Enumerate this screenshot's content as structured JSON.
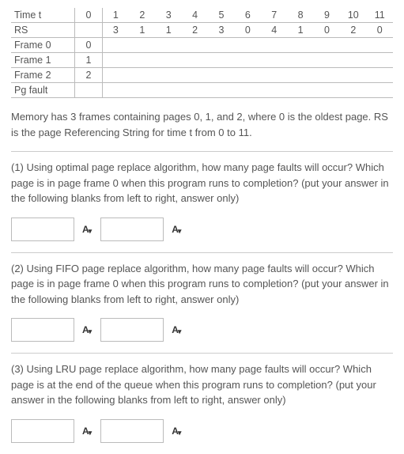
{
  "table": {
    "headers": [
      "Time t",
      "RS",
      "Frame 0",
      "Frame 1",
      "Frame 2",
      "Pg fault"
    ],
    "time": [
      "0",
      "1",
      "2",
      "3",
      "4",
      "5",
      "6",
      "7",
      "8",
      "9",
      "10",
      "11"
    ],
    "rs": [
      "",
      "3",
      "1",
      "1",
      "2",
      "3",
      "0",
      "4",
      "1",
      "0",
      "2",
      "0"
    ],
    "frame0": [
      "0",
      "",
      "",
      "",
      "",
      "",
      "",
      "",
      "",
      "",
      "",
      ""
    ],
    "frame1": [
      "1",
      "",
      "",
      "",
      "",
      "",
      "",
      "",
      "",
      "",
      "",
      ""
    ],
    "frame2": [
      "2",
      "",
      "",
      "",
      "",
      "",
      "",
      "",
      "",
      "",
      "",
      ""
    ],
    "pgfault": [
      "",
      "",
      "",
      "",
      "",
      "",
      "",
      "",
      "",
      "",
      "",
      ""
    ]
  },
  "description": "Memory has 3 frames containing pages 0, 1, and 2, where 0 is the oldest page. RS is the page Referencing String for time t from 0 to 11.",
  "questions": {
    "q1": "(1) Using optimal page replace algorithm, how many page faults will occur? Which page is in page frame 0 when this program runs to completion? (put your answer in the following blanks from left to right, answer only)",
    "q2": "(2) Using FIFO page replace algorithm, how many page faults will occur? Which page is in page frame 0 when this program runs to completion? (put your answer in the following blanks from left to right, answer only)",
    "q3": "(3) Using LRU page replace algorithm, how many page faults will occur? Which page is at the end of the queue when this program runs to completion? (put your answer in the following blanks from left to right, answer only)"
  },
  "icon_label": "A"
}
